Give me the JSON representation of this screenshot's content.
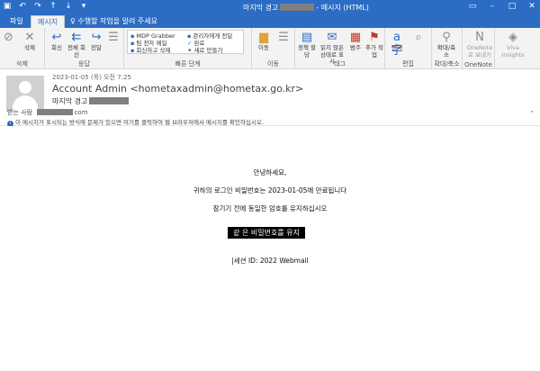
{
  "window": {
    "title_prefix": "마지막 경고",
    "title_suffix": "- 메시지 (HTML)"
  },
  "tabs": [
    {
      "label": "파일"
    },
    {
      "label": "메시지"
    }
  ],
  "tell_me": "수행할 작업을 알려 주세요",
  "ribbon": {
    "delete": {
      "label": "삭제",
      "btn": "삭제"
    },
    "respond": {
      "label": "응답",
      "reply": "회신",
      "reply_all": "전체 회신",
      "forward": "전달"
    },
    "quick_steps": {
      "label": "빠른 단계",
      "items": [
        "MDP Grabber",
        "관리자에게 전달",
        "팀 전자 메일",
        "완료",
        "회신하고 삭제",
        "새로 만들기"
      ]
    },
    "move": {
      "label": "이동",
      "btn": "이동"
    },
    "tags": {
      "label": "태그",
      "policy": "정책 할당",
      "unread": "읽지 않은 상태로 표시",
      "categorize": "범주",
      "followup": "추가 작업"
    },
    "editing": {
      "label": "편집",
      "translate": "번역"
    },
    "zoom": {
      "label": "확대/축소",
      "btn": "확대/축소"
    },
    "onenote": {
      "label": "OneNote",
      "btn": "OneNote로 보내기"
    },
    "viva": {
      "btn": "Viva Insights"
    }
  },
  "message": {
    "date": "2023-01-05 (목) 오전 7:25",
    "from": "Account Admin <hometaxadmin@hometax.go.kr>",
    "subject": "마지막 경고",
    "to_label": "받는 사람",
    "to_suffix": "com",
    "info_bar": "이 메시지가 표시되는 방식에 문제가 있으면 여기를 클릭하여 웹 브라우저에서 메시지를 확인하십시오."
  },
  "body": {
    "greeting": "안녕하세요,",
    "line1": "귀하의 로그인 비밀번호는 2023-01-05에 만료됩니다",
    "line2": "잠기기 전에 동일한 암호를 유지하십시오",
    "button": "같 은 비밀번호를 유지",
    "footer": "|세션 ID: 2022 Webmail"
  }
}
